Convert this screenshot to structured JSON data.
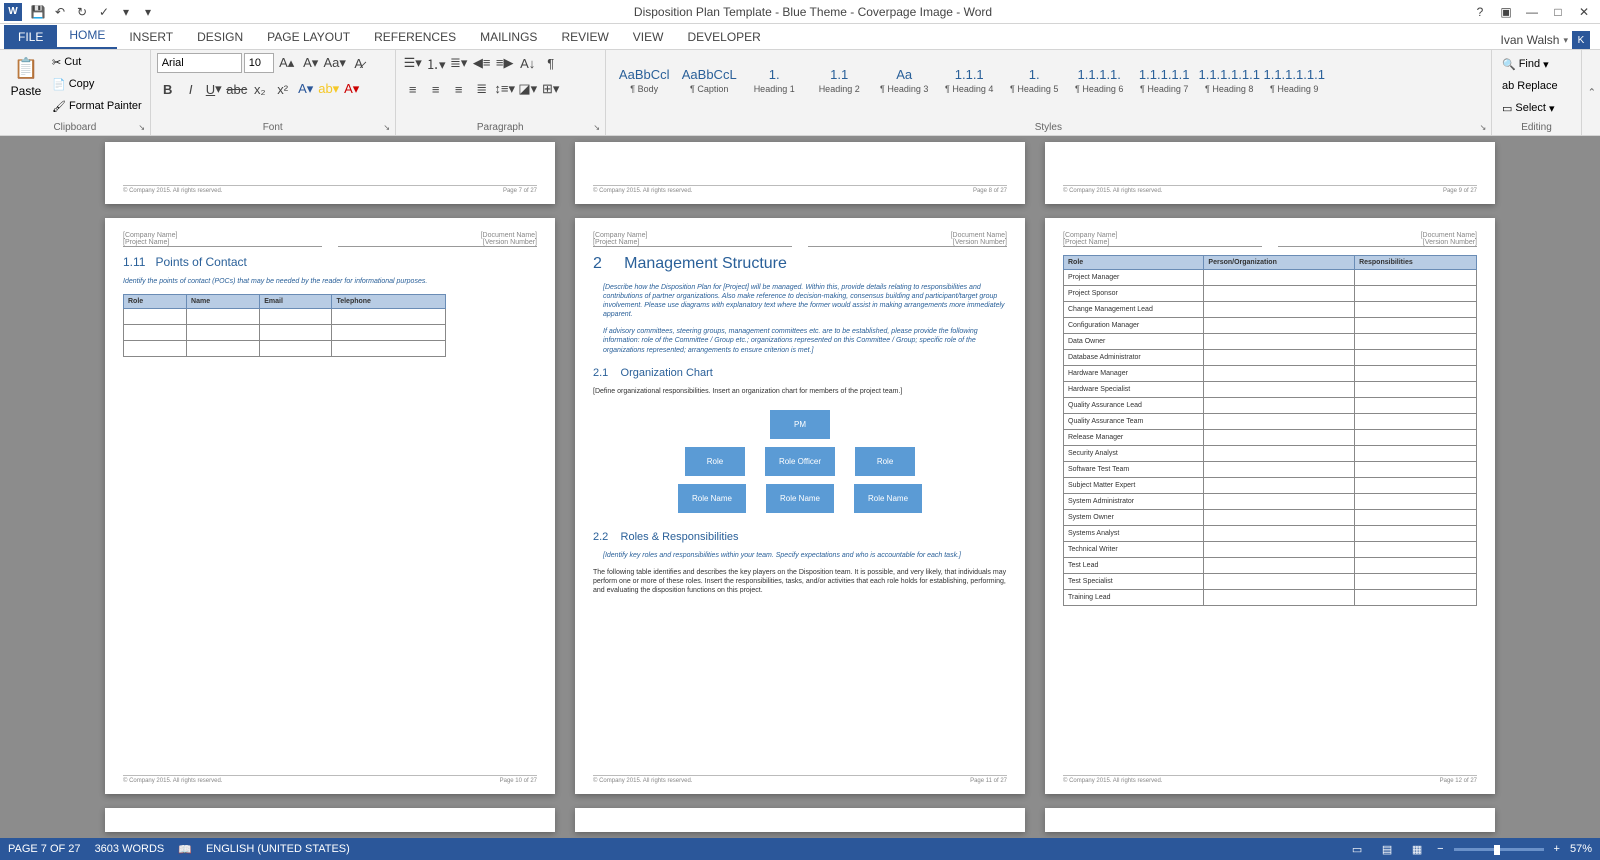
{
  "title": "Disposition Plan Template - Blue Theme - Coverpage Image - Word",
  "user": "Ivan Walsh",
  "tabs": {
    "file": "FILE",
    "home": "HOME",
    "insert": "INSERT",
    "design": "DESIGN",
    "layout": "PAGE LAYOUT",
    "refs": "REFERENCES",
    "mail": "MAILINGS",
    "review": "REVIEW",
    "view": "VIEW",
    "dev": "DEVELOPER"
  },
  "clipboard": {
    "paste": "Paste",
    "cut": "Cut",
    "copy": "Copy",
    "fmt": "Format Painter",
    "label": "Clipboard"
  },
  "font": {
    "name": "Arial",
    "size": "10",
    "label": "Font"
  },
  "paragraph": {
    "label": "Paragraph"
  },
  "styles": {
    "label": "Styles",
    "items": [
      {
        "preview": "AaBbCcl",
        "name": "¶ Body"
      },
      {
        "preview": "AaBbCcL",
        "name": "¶ Caption"
      },
      {
        "preview": "1.",
        "name": "Heading 1"
      },
      {
        "preview": "1.1",
        "name": "Heading 2"
      },
      {
        "preview": "Aa",
        "name": "¶ Heading 3"
      },
      {
        "preview": "1.1.1",
        "name": "¶ Heading 4"
      },
      {
        "preview": "1.",
        "name": "¶ Heading 5"
      },
      {
        "preview": "1.1.1.1.",
        "name": "¶ Heading 6"
      },
      {
        "preview": "1.1.1.1.1",
        "name": "¶ Heading 7"
      },
      {
        "preview": "1.1.1.1.1.1",
        "name": "¶ Heading 8"
      },
      {
        "preview": "1.1.1.1.1.1",
        "name": "¶ Heading 9"
      }
    ]
  },
  "editing": {
    "find": "Find",
    "replace": "Replace",
    "select": "Select",
    "label": "Editing"
  },
  "doc": {
    "company": "[Company Name]",
    "project": "[Project Name]",
    "docname": "[Document Name]",
    "version": "[Version Number]",
    "copyright": "© Company 2015. All rights reserved.",
    "page7": "Page 7 of 27",
    "page8": "Page 8 of 27",
    "page9": "Page 9 of 27",
    "page10": "Page 10 of 27",
    "page11": "Page 11 of 27",
    "page12": "Page 12 of 27",
    "p1": {
      "sec": "1.11",
      "title": "Points of Contact",
      "note": "Identify the points of contact (POCs) that may be needed by the reader for informational purposes.",
      "th": [
        "Role",
        "Name",
        "Email",
        "Telephone"
      ]
    },
    "p2": {
      "sec": "2",
      "title": "Management Structure",
      "note1": "[Describe how the Disposition Plan for [Project] will be managed. Within this, provide details relating to responsibilities and contributions of partner organizations. Also make reference to decision-making, consensus building and participant/target group involvement. Please use diagrams with explanatory text where the former would assist in making arrangements more immediately apparent.",
      "note2": "If advisory committees, steering groups, management committees etc. are to be established, please provide the following information: role of the Committee / Group etc.; organizations represented on this Committee / Group; specific role of the organizations represented; arrangements to ensure criterion is met.]",
      "sub1n": "2.1",
      "sub1": "Organization Chart",
      "sub1txt": "[Define organizational responsibilities. Insert an organization chart for members of the project team.]",
      "org": {
        "top": "PM",
        "mid": [
          "Role",
          "Role Officer",
          "Role"
        ],
        "bot": [
          "Role Name",
          "Role Name",
          "Role Name"
        ]
      },
      "sub2n": "2.2",
      "sub2": "Roles & Responsibilities",
      "sub2note": "[Identify key roles and responsibilities within your team. Specify expectations and who is accountable for each task.]",
      "sub2txt": "The following table identifies and describes the key players on the Disposition team. It is possible, and very likely, that individuals may perform one or more of these roles. Insert the responsibilities, tasks, and/or activities that each role holds for establishing, performing, and evaluating the disposition functions on this project."
    },
    "p3": {
      "th": [
        "Role",
        "Person/Organization",
        "Responsibilities"
      ],
      "rows": [
        "Project Manager",
        "Project Sponsor",
        "Change Management Lead",
        "Configuration Manager",
        "Data Owner",
        "Database Administrator",
        "Hardware Manager",
        "Hardware Specialist",
        "Quality Assurance Lead",
        "Quality Assurance Team",
        "Release Manager",
        "Security Analyst",
        "Software Test Team",
        "Subject Matter Expert",
        "System Administrator",
        "System Owner",
        "Systems Analyst",
        "Technical Writer",
        "Test Lead",
        "Test Specialist",
        "Training Lead"
      ]
    }
  },
  "status": {
    "page": "PAGE 7 OF 27",
    "words": "3603 WORDS",
    "lang": "ENGLISH (UNITED STATES)",
    "zoom": "57%"
  }
}
